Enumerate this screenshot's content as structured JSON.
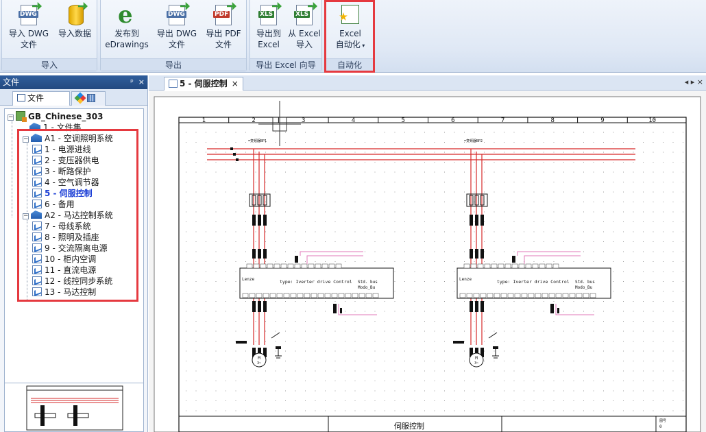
{
  "ribbon": {
    "groups": {
      "import": "导入",
      "export": "导出",
      "export_excel": "导出 Excel 向导",
      "automation": "自动化"
    },
    "buttons": {
      "import_dwg_line1": "导入 DWG",
      "import_dwg_line2": "文件",
      "import_data": "导入数据",
      "publish_line1": "发布到",
      "publish_line2": "eDrawings",
      "export_dwg_line1": "导出 DWG",
      "export_dwg_line2": "文件",
      "export_pdf_line1": "导出 PDF",
      "export_pdf_line2": "文件",
      "export_excel_line1": "导出到",
      "export_excel_line2": "Excel",
      "from_excel_line1": "从 Excel",
      "from_excel_line2": "导入",
      "excel_auto_line1": "Excel",
      "excel_auto_line2": "自动化"
    },
    "icon_tags": {
      "dwg": "DWG",
      "pdf": "PDF",
      "xls": "XLS"
    }
  },
  "panel": {
    "title": "文件",
    "pin": "ᵖ",
    "close": "×",
    "tab_files": "文件"
  },
  "tree": {
    "project": "GB_Chinese_303",
    "file_set": "1 - 文件集",
    "group_a1": "A1 - 空调照明系统",
    "group_a2": "A2 - 马达控制系统",
    "a1_items": [
      "1 - 电源进线",
      "2 - 变压器供电",
      "3 - 断路保护",
      "4 - 空气调节器",
      "5 - 伺服控制",
      "6 - 备用"
    ],
    "a2_items": [
      "7 - 母线系统",
      "8 - 照明及插座",
      "9 - 交流隔离电源",
      "10 - 柜内空调",
      "11 - 直流电源",
      "12 - 线控同步系统",
      "13 - 马达控制"
    ],
    "active_index": 4
  },
  "document": {
    "tab_label": "5 - 伺服控制",
    "tab_close": "×",
    "nav": "◂ ▸ ×",
    "columns": [
      "1",
      "2",
      "3",
      "4",
      "5",
      "6",
      "7",
      "8",
      "9",
      "10"
    ],
    "title_block": "伺服控制",
    "title_small": "图号",
    "title_small2": "0",
    "drive_type": "type: Iverter drive Control",
    "drive_bus": "Std. bus",
    "drive_mode": "Modo_Bu",
    "drive_brand": "Lenze",
    "motor_left": "M",
    "motor_sub": "3~"
  },
  "colors": {
    "accent": "#2f5d9c",
    "highlight": "#e5393f",
    "wire_red": "#d62828",
    "wire_pink": "#e07ab8",
    "active_item": "#1c3fd6"
  }
}
